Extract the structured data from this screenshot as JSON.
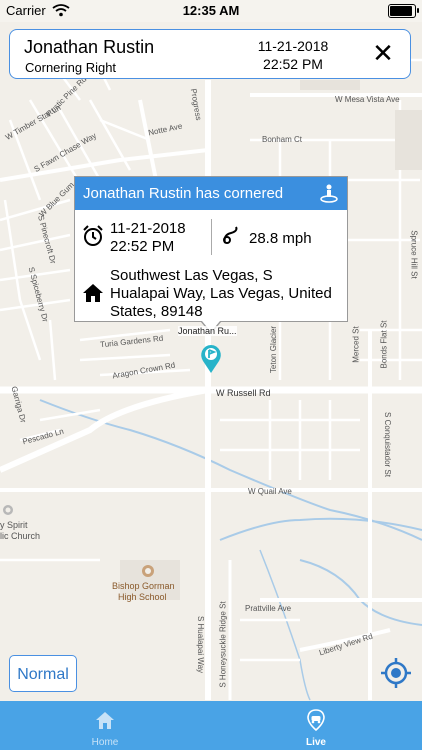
{
  "status_bar": {
    "carrier": "Carrier",
    "time": "12:35 AM",
    "battery_level": 1.0
  },
  "event_card": {
    "driver_name": "Jonathan Rustin",
    "event_type": "Cornering Right",
    "date": "11-21-2018",
    "time": "22:52 PM",
    "close_icon": "close-icon"
  },
  "popup": {
    "title": "Jonathan Rustin has cornered",
    "date": "11-21-2018",
    "time": "22:52 PM",
    "speed": "28.8 mph",
    "address_line1": "Southwest Las Vegas, S",
    "address_line2": "Hualapai Way, Las Vegas, United",
    "address_line3": "States, 89148",
    "header_color": "#3b8fdf"
  },
  "marker_label": "Jonathan Ru...",
  "map_labels": {
    "mesa_vista": "W Mesa Vista Ave",
    "bonham": "Bonham Ct",
    "notte": "Notte Ave",
    "timber_star": "W Timber Star Ln",
    "fawn_chase": "S Fawn Chase Way",
    "rustic_pine": "Rustic Pine Rd",
    "blue_gum": "W Blue Gum",
    "pinecroft": "S Pinecroft Dr",
    "spiceberry": "S Spiceberry Dr",
    "turia": "Turia Gardens Rd",
    "aragon": "Aragon Crown Rd",
    "russell": "W Russell Rd",
    "garriga": "Garriga Dr",
    "pescado": "Pescado Ln",
    "teton": "Teton Glacier",
    "merced": "Merced St",
    "bonds_flat": "Bonds Flat St",
    "spruce_hill": "Spruce Hill St",
    "conquistador": "S Conquistador St",
    "quail": "W Quail Ave",
    "spirit": "y Spirit",
    "church": "lic Church",
    "bishop1": "Bishop Gorman",
    "bishop2": "High School",
    "prattville": "Prattville Ave",
    "liberty": "Liberty View Rd",
    "honeysuckle": "S Honeysuckle Ridge St",
    "hualapai": "S Hualapai Way",
    "progress": "Progress"
  },
  "controls": {
    "map_type_button": "Normal",
    "locate_icon": "locate-icon"
  },
  "tabs": [
    {
      "label": "Home",
      "icon": "home-icon",
      "active": false
    },
    {
      "label": "Live",
      "icon": "car-icon",
      "active": true
    }
  ],
  "colors": {
    "accent": "#4a90e2",
    "tabbar": "#49a3e6",
    "tab_active": "#ffffff",
    "tab_inactive": "#c7e2f7"
  }
}
